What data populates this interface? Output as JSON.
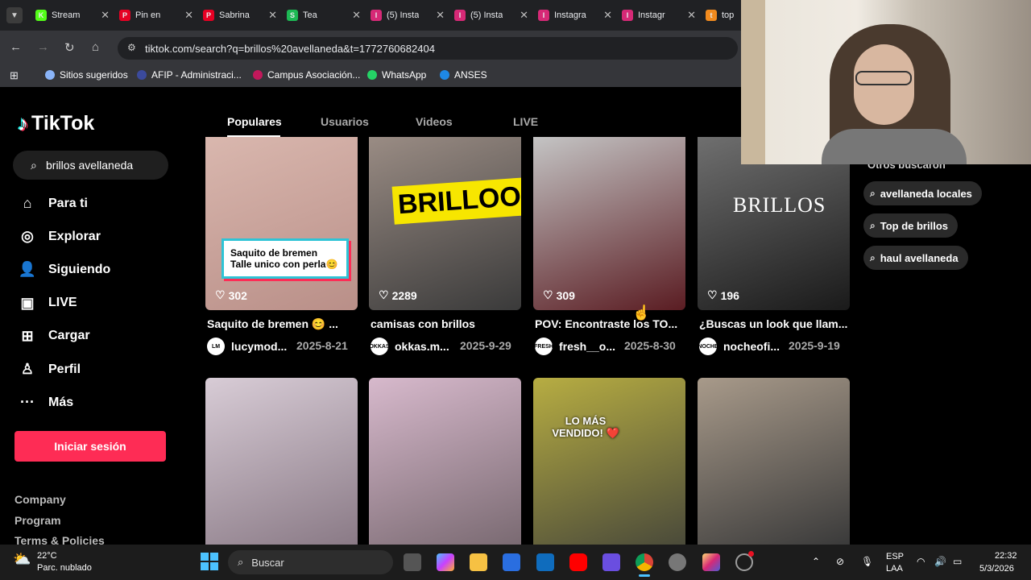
{
  "browser": {
    "tabs": [
      {
        "icon_letter": "K",
        "title": "Stream",
        "color": "#53fc18"
      },
      {
        "icon_letter": "P",
        "title": "Pin en",
        "color": "#e60023"
      },
      {
        "icon_letter": "P",
        "title": "Sabrina",
        "color": "#e60023"
      },
      {
        "icon_letter": "S",
        "title": "Tea",
        "color": "#1db954"
      },
      {
        "icon_letter": "I",
        "title": "(5) Insta",
        "color": "#d62976"
      },
      {
        "icon_letter": "I",
        "title": "(5) Insta",
        "color": "#d62976"
      },
      {
        "icon_letter": "I",
        "title": "Instagra",
        "color": "#d62976"
      },
      {
        "icon_letter": "I",
        "title": "Instagr",
        "color": "#d62976"
      },
      {
        "icon_letter": "t",
        "title": "top",
        "color": "#f28b1e"
      }
    ],
    "url": "tiktok.com/search?q=brillos%20avellaneda&t=1772760682404",
    "bookmarks": [
      {
        "label": "Sitios sugeridos",
        "color": "#8ab4f8"
      },
      {
        "label": "AFIP - Administraci...",
        "color": "#3b4a9c"
      },
      {
        "label": "Campus Asociación...",
        "color": "#c2185b"
      },
      {
        "label": "WhatsApp",
        "color": "#25d366"
      },
      {
        "label": "ANSES",
        "color": "#1e88e5"
      }
    ]
  },
  "tiktok": {
    "logo": "TikTok",
    "search_value": "brillos avellaneda",
    "nav": [
      {
        "label": "Para ti",
        "icon": "home-icon"
      },
      {
        "label": "Explorar",
        "icon": "compass-icon"
      },
      {
        "label": "Siguiendo",
        "icon": "following-icon"
      },
      {
        "label": "LIVE",
        "icon": "live-icon"
      },
      {
        "label": "Cargar",
        "icon": "upload-icon"
      },
      {
        "label": "Perfil",
        "icon": "profile-icon"
      },
      {
        "label": "Más",
        "icon": "more-icon"
      }
    ],
    "login_label": "Iniciar sesión",
    "footer": [
      "Company",
      "Program",
      "Terms & Policies"
    ],
    "tabs": [
      "Populares",
      "Usuarios",
      "Videos",
      "LIVE"
    ],
    "others_searched_heading": "Otros buscaron",
    "suggestions": [
      "avellaneda locales",
      "Top de brillos",
      "haul avellaneda"
    ],
    "videos": [
      {
        "likes": "302",
        "title": "Saquito de bremen 😊 ...",
        "user": "lucymod...",
        "date": "2025-8-21",
        "overlay": "Saquito de bremen\nTalle unico con perla😊",
        "avatar": "LM",
        "colors": [
          "#b98f88",
          "#d9b7ae"
        ]
      },
      {
        "likes": "2289",
        "title": "camisas con brillos",
        "user": "okkas.m...",
        "date": "2025-9-29",
        "overlay": "BRILLOO",
        "avatar": "OKKAS",
        "colors": [
          "#3a3a3a",
          "#9a8c84"
        ]
      },
      {
        "likes": "309",
        "title": "POV: Encontraste los TO...",
        "user": "fresh__o...",
        "date": "2025-8-30",
        "overlay": "",
        "avatar": "FRESH",
        "colors": [
          "#5a1c22",
          "#c4c4c4"
        ]
      },
      {
        "likes": "196",
        "title": "¿Buscas un look que llam...",
        "user": "nocheofi...",
        "date": "2025-9-19",
        "overlay": "BRILLOS",
        "avatar": "NOCHE",
        "colors": [
          "#1a1a1a",
          "#6f6f6f"
        ]
      },
      {
        "likes": "",
        "title": "",
        "user": "",
        "date": "",
        "overlay": "",
        "avatar": "",
        "colors": [
          "#8a7a86",
          "#d8ccd6"
        ]
      },
      {
        "likes": "",
        "title": "",
        "user": "",
        "date": "",
        "overlay": "",
        "avatar": "",
        "colors": [
          "#7a6a72",
          "#d7b9cc"
        ]
      },
      {
        "likes": "",
        "title": "",
        "user": "",
        "date": "",
        "overlay": "LO MÁS\nVENDIDO! ❤️",
        "avatar": "",
        "colors": [
          "#4a4a3a",
          "#b7ad42"
        ]
      },
      {
        "likes": "",
        "title": "",
        "user": "",
        "date": "",
        "overlay": "",
        "avatar": "",
        "colors": [
          "#3a3a3a",
          "#a89a8a"
        ]
      }
    ]
  },
  "taskbar": {
    "weather_temp": "22°C",
    "weather_desc": "Parc. nublado",
    "search_placeholder": "Buscar",
    "lang_top": "ESP",
    "lang_bottom": "LAA",
    "time": "22:32",
    "date": "5/3/2026"
  }
}
